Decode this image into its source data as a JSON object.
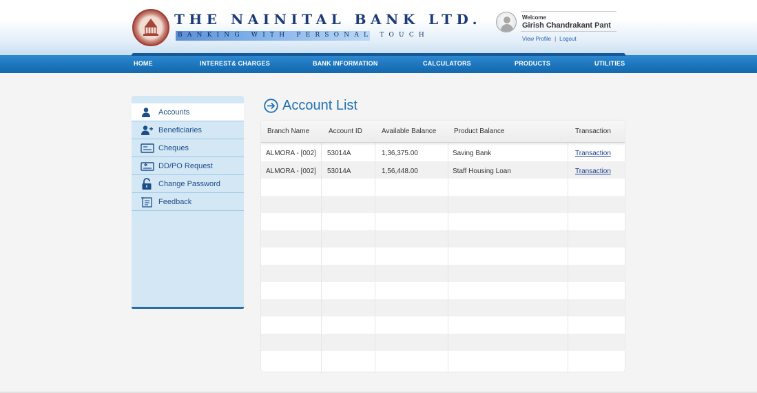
{
  "header": {
    "bank_name": "THE NAINITAL BANK LTD.",
    "tagline": "BANKING WITH PERSONAL TOUCH"
  },
  "user": {
    "welcome_label": "Welcome",
    "name": "Girish Chandrakant Pant",
    "view_profile": "View Profile",
    "separator": "|",
    "logout": "Logout"
  },
  "nav": {
    "home": "HOME",
    "interest": "INTEREST& CHARGES",
    "bank_info": "BANK INFORMATION",
    "calculators": "CALCULATORS",
    "products": "PRODUCTS",
    "utilities": "UTILITIES"
  },
  "sidebar": {
    "items": [
      {
        "label": "Accounts",
        "icon": "user-icon"
      },
      {
        "label": "Beneficiaries",
        "icon": "add-user-icon"
      },
      {
        "label": "Cheques",
        "icon": "cheque-icon"
      },
      {
        "label": "DD/PO Request",
        "icon": "dd-request-icon"
      },
      {
        "label": "Change Password",
        "icon": "lock-icon"
      },
      {
        "label": "Feedback",
        "icon": "feedback-icon"
      }
    ]
  },
  "main": {
    "title": "Account List",
    "columns": [
      "Branch Name",
      "Account ID",
      "Available Balance",
      "Product Balance",
      "Transaction"
    ],
    "rows": [
      {
        "branch": "ALMORA - [002]",
        "account_id": "53014A",
        "balance": "1,36,375.00",
        "product": "Saving Bank",
        "transaction": "Transaction"
      },
      {
        "branch": "ALMORA - [002]",
        "account_id": "53014A",
        "balance": "1,56,448.00",
        "product": "Staff Housing Loan",
        "transaction": "Transaction"
      }
    ]
  },
  "colors": {
    "nav_blue": "#1e77bf",
    "title_blue": "#1f6fb5",
    "sidebar_bg": "#d3e7f5",
    "bank_name": "#1a3a78"
  }
}
